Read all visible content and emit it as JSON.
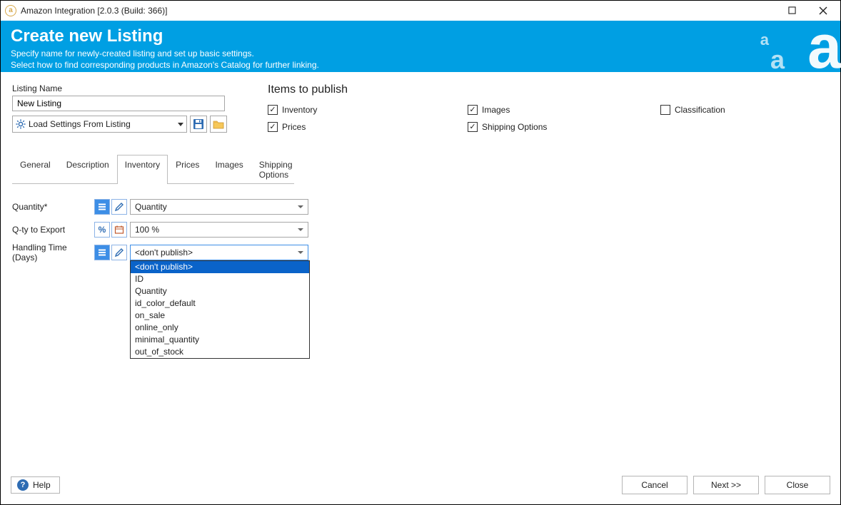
{
  "window": {
    "title": "Amazon Integration [2.0.3 (Build: 366)]"
  },
  "header": {
    "title": "Create new Listing",
    "desc1": "Specify name for newly-created listing and set up basic settings.",
    "desc2": "Select how to find corresponding products in Amazon's Catalog for further linking."
  },
  "listing": {
    "name_label": "Listing Name",
    "name_value": "New Listing",
    "load_label": "Load Settings From Listing"
  },
  "publish": {
    "heading": "Items to publish",
    "inventory": "Inventory",
    "prices": "Prices",
    "images": "Images",
    "shipping": "Shipping Options",
    "classification": "Classification"
  },
  "tabs": {
    "general": "General",
    "description": "Description",
    "inventory": "Inventory",
    "prices": "Prices",
    "images": "Images",
    "shipping": "Shipping Options"
  },
  "form": {
    "quantity_label": "Quantity*",
    "quantity_value": "Quantity",
    "qty_export_label": "Q-ty to Export",
    "qty_export_value": "100 %",
    "handling_label": "Handling Time (Days)",
    "handling_value": "<don't publish>"
  },
  "dropdown": {
    "options": [
      "<don't publish>",
      "ID",
      "Quantity",
      "id_color_default",
      "on_sale",
      "online_only",
      "minimal_quantity",
      "out_of_stock"
    ]
  },
  "footer": {
    "help": "Help",
    "cancel": "Cancel",
    "next": "Next >>",
    "close": "Close"
  }
}
